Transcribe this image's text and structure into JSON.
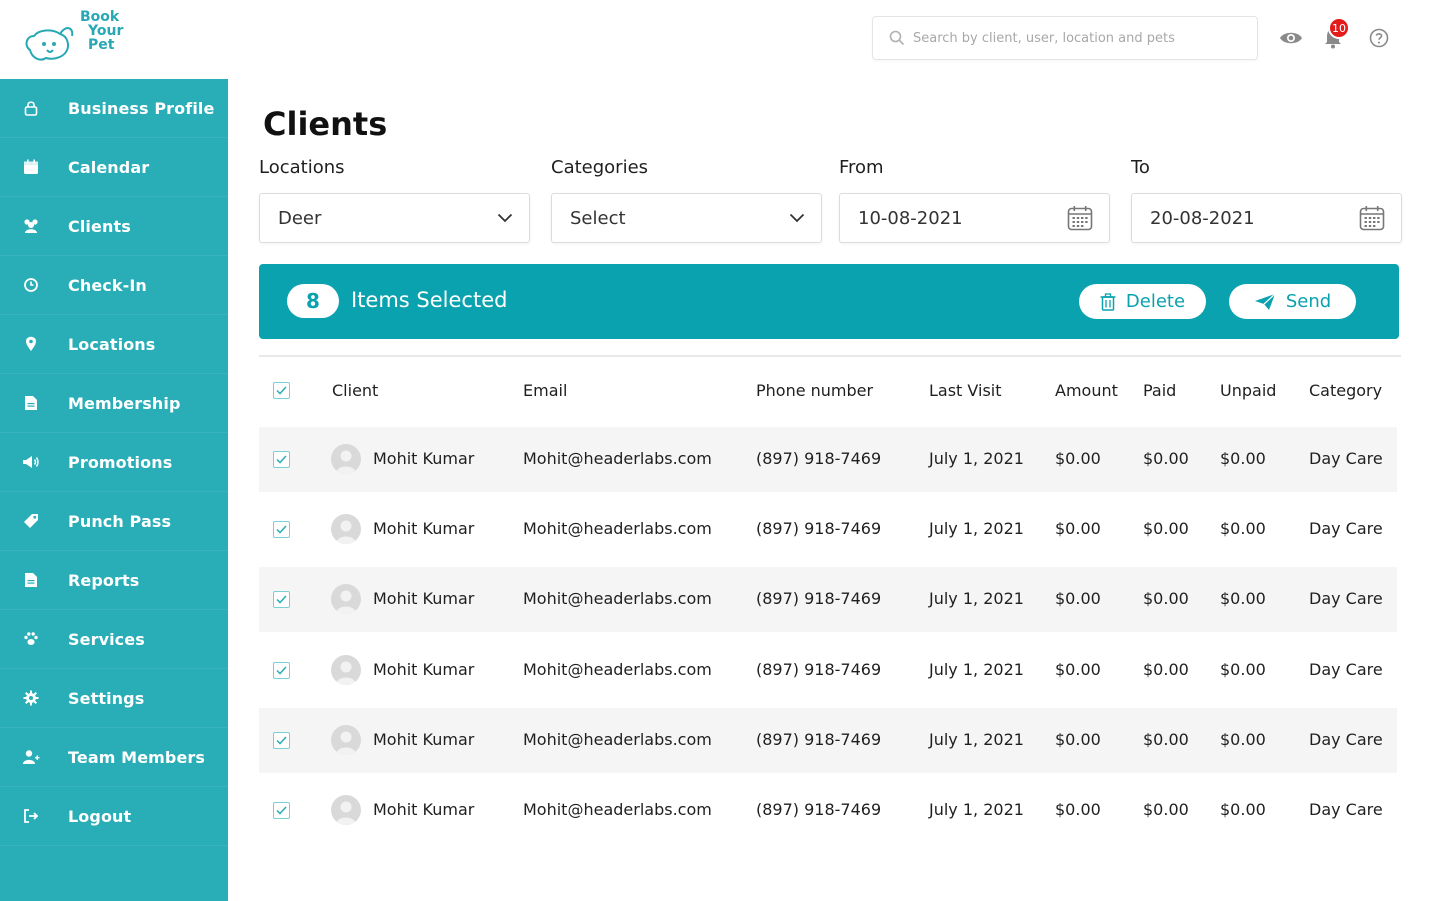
{
  "brand": {
    "line1": "Book",
    "line2": "Your",
    "line3": "Pet"
  },
  "header": {
    "search_placeholder": "Search by client, user, location and pets",
    "notification_count": "10"
  },
  "sidebar": {
    "items": [
      {
        "label": "Business Profile",
        "icon": "lock-icon"
      },
      {
        "label": "Calendar",
        "icon": "calendar-icon"
      },
      {
        "label": "Clients",
        "icon": "users-icon"
      },
      {
        "label": "Check-In",
        "icon": "clock-icon"
      },
      {
        "label": "Locations",
        "icon": "map-pin-icon"
      },
      {
        "label": "Membership",
        "icon": "document-icon"
      },
      {
        "label": "Promotions",
        "icon": "megaphone-icon"
      },
      {
        "label": "Punch Pass",
        "icon": "tag-icon"
      },
      {
        "label": "Reports",
        "icon": "report-icon"
      },
      {
        "label": "Services",
        "icon": "paw-icon"
      },
      {
        "label": "Settings",
        "icon": "gear-icon"
      },
      {
        "label": "Team Members",
        "icon": "add-user-icon"
      },
      {
        "label": "Logout",
        "icon": "logout-icon"
      }
    ]
  },
  "page": {
    "title": "Clients"
  },
  "filters": {
    "locations": {
      "label": "Locations",
      "value": "Deer"
    },
    "categories": {
      "label": "Categories",
      "value": "Select"
    },
    "from": {
      "label": "From",
      "value": "10-08-2021"
    },
    "to": {
      "label": "To",
      "value": "20-08-2021"
    }
  },
  "selection": {
    "count": "8",
    "text": "Items Selected",
    "delete_label": "Delete",
    "send_label": "Send"
  },
  "table": {
    "columns": [
      "Client",
      "Email",
      "Phone number",
      "Last Visit",
      "Amount",
      "Paid",
      "Unpaid",
      "Category"
    ],
    "rows": [
      {
        "client": "Mohit Kumar",
        "email": "Mohit@headerlabs.com",
        "phone": "(897) 918-7469",
        "last_visit": "July 1, 2021",
        "amount": "$0.00",
        "paid": "$0.00",
        "unpaid": "$0.00",
        "category": "Day Care",
        "checked": true
      },
      {
        "client": "Mohit Kumar",
        "email": "Mohit@headerlabs.com",
        "phone": "(897) 918-7469",
        "last_visit": "July 1, 2021",
        "amount": "$0.00",
        "paid": "$0.00",
        "unpaid": "$0.00",
        "category": "Day Care",
        "checked": true
      },
      {
        "client": "Mohit Kumar",
        "email": "Mohit@headerlabs.com",
        "phone": "(897) 918-7469",
        "last_visit": "July 1, 2021",
        "amount": "$0.00",
        "paid": "$0.00",
        "unpaid": "$0.00",
        "category": "Day Care",
        "checked": true
      },
      {
        "client": "Mohit Kumar",
        "email": "Mohit@headerlabs.com",
        "phone": "(897) 918-7469",
        "last_visit": "July 1, 2021",
        "amount": "$0.00",
        "paid": "$0.00",
        "unpaid": "$0.00",
        "category": "Day Care",
        "checked": true
      },
      {
        "client": "Mohit Kumar",
        "email": "Mohit@headerlabs.com",
        "phone": "(897) 918-7469",
        "last_visit": "July 1, 2021",
        "amount": "$0.00",
        "paid": "$0.00",
        "unpaid": "$0.00",
        "category": "Day Care",
        "checked": true
      },
      {
        "client": "Mohit Kumar",
        "email": "Mohit@headerlabs.com",
        "phone": "(897) 918-7469",
        "last_visit": "July 1, 2021",
        "amount": "$0.00",
        "paid": "$0.00",
        "unpaid": "$0.00",
        "category": "Day Care",
        "checked": true
      }
    ]
  },
  "colors": {
    "accent": "#29adb7",
    "bar": "#0aa2ae",
    "badge": "#e31b1b"
  }
}
